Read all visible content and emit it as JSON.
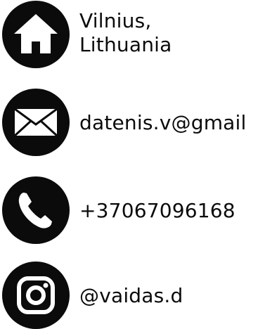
{
  "contact": {
    "address": {
      "line1": "Vilnius,",
      "line2": "Lithuania",
      "icon": "home-icon"
    },
    "email": {
      "value": "datenis.v@gmail",
      "icon": "envelope-icon"
    },
    "phone": {
      "value": "+37067096168",
      "icon": "phone-icon"
    },
    "instagram": {
      "value": "@vaidas.d",
      "icon": "instagram-icon"
    }
  },
  "colors": {
    "icon_fill": "#0b0b0b",
    "icon_glyph": "#ffffff",
    "text": "#0b0b0b"
  }
}
